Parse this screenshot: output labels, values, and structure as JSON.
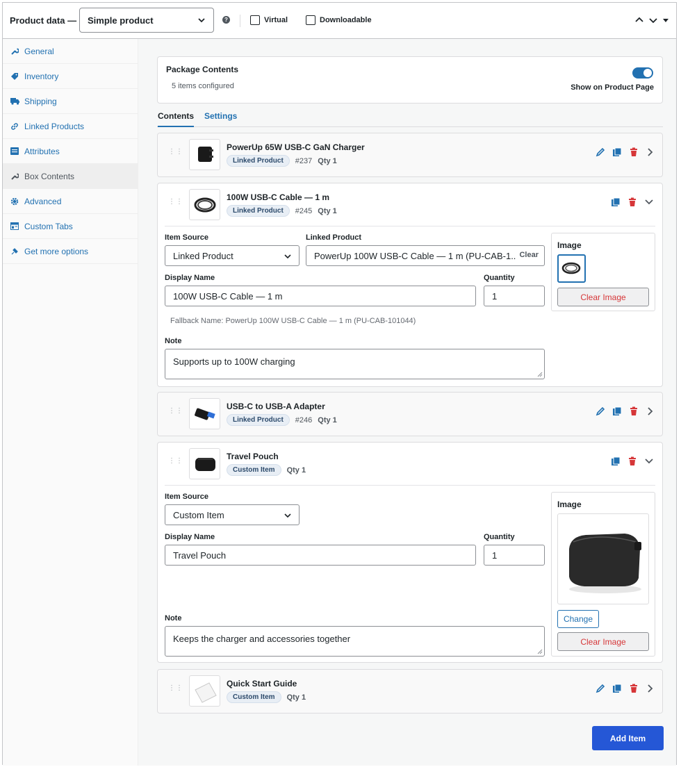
{
  "header": {
    "label": "Product data —",
    "product_type": "Simple product",
    "help": "?",
    "virtual_label": "Virtual",
    "downloadable_label": "Downloadable"
  },
  "sidebar": {
    "items": [
      {
        "label": "General",
        "icon": "wrench-icon"
      },
      {
        "label": "Inventory",
        "icon": "tag-icon"
      },
      {
        "label": "Shipping",
        "icon": "truck-icon"
      },
      {
        "label": "Linked Products",
        "icon": "link-icon"
      },
      {
        "label": "Attributes",
        "icon": "list-icon"
      },
      {
        "label": "Box Contents",
        "icon": "wrench-icon",
        "active": true
      },
      {
        "label": "Advanced",
        "icon": "gear-icon"
      },
      {
        "label": "Custom Tabs",
        "icon": "tabs-icon"
      },
      {
        "label": "Get more options",
        "icon": "plug-icon"
      }
    ]
  },
  "package": {
    "title": "Package Contents",
    "subtitle": "5 items configured",
    "toggle_label": "Show on Product Page",
    "toggle_on": true
  },
  "tabs": {
    "contents": "Contents",
    "settings": "Settings"
  },
  "items": [
    {
      "title": "PowerUp 65W USB-C GaN Charger",
      "badge": "Linked Product",
      "id": "#237",
      "qty": "Qty 1"
    },
    {
      "title": "100W USB-C Cable — 1 m",
      "badge": "Linked Product",
      "id": "#245",
      "qty": "Qty 1",
      "form": {
        "source_label": "Item Source",
        "source_value": "Linked Product",
        "linked_label": "Linked Product",
        "linked_value": "PowerUp 100W USB-C Cable — 1 m (PU-CAB-1...",
        "linked_clear": "Clear",
        "display_label": "Display Name",
        "display_value": "100W USB-C Cable — 1 m",
        "qty_label": "Quantity",
        "qty_value": "1",
        "fallback": "Fallback Name: PowerUp 100W USB-C Cable — 1 m (PU-CAB-101044)",
        "note_label": "Note",
        "note_value": "Supports up to 100W charging",
        "image_label": "Image",
        "clear_image": "Clear Image"
      }
    },
    {
      "title": "USB-C to USB-A Adapter",
      "badge": "Linked Product",
      "id": "#246",
      "qty": "Qty 1"
    },
    {
      "title": "Travel Pouch",
      "badge": "Custom Item",
      "qty": "Qty 1",
      "form": {
        "source_label": "Item Source",
        "source_value": "Custom Item",
        "display_label": "Display Name",
        "display_value": "Travel Pouch",
        "qty_label": "Quantity",
        "qty_value": "1",
        "note_label": "Note",
        "note_value": "Keeps the charger and accessories together",
        "image_label": "Image",
        "change": "Change",
        "clear_image": "Clear Image"
      }
    },
    {
      "title": "Quick Start Guide",
      "badge": "Custom Item",
      "qty": "Qty 1"
    }
  ],
  "add_button": "Add Item",
  "colors": {
    "accent": "#2271b1",
    "danger": "#d63638",
    "primary_button": "#2557d6"
  }
}
